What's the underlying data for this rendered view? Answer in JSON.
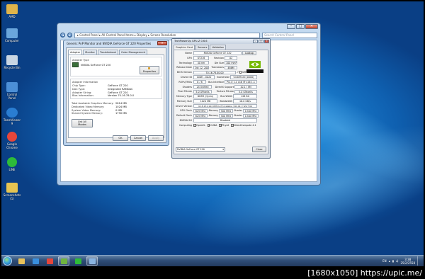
{
  "desktop_icons": [
    {
      "label": "AMD",
      "color": "#e0b44a"
    },
    {
      "label": "Computer",
      "color": "#6aa6dc"
    },
    {
      "label": "Recycle Bin",
      "color": "#c9d6e3"
    },
    {
      "label": "Control Panel",
      "color": "#4c8fd6"
    },
    {
      "label": "TeamViewer 9",
      "color": "#2a7dd1"
    },
    {
      "label": "Google Chrome",
      "color": "#e5463b"
    },
    {
      "label": "LINE",
      "color": "#2dbb39"
    },
    {
      "label": "Screenshots (1)",
      "color": "#e6c451"
    }
  ],
  "explorer": {
    "nav_back": "◄",
    "nav_fwd": "►",
    "breadcrumb": "▸ Control Panel ▸ All Control Panel Items ▸ Display ▸ Screen Resolution",
    "search_placeholder": "Search Control Panel",
    "btn_min": "–",
    "btn_max": "□",
    "btn_close": "✕"
  },
  "props": {
    "title": "Generic PnP Monitor and NVIDIA GeForce GT 220 Properties",
    "close": "✕",
    "tabs": [
      "Adapter",
      "Monitor",
      "Troubleshoot",
      "Color Management"
    ],
    "adapter_type_label": "Adapter Type",
    "adapter_type_value": "NVIDIA GeForce GT 220",
    "properties_button": "Properties",
    "info_label": "Adapter Information",
    "info": [
      {
        "k": "Chip Type:",
        "v": "GeForce GT 220"
      },
      {
        "k": "DAC Type:",
        "v": "Integrated RAMDAC"
      },
      {
        "k": "Adapter String:",
        "v": "GeForce GT 220"
      },
      {
        "k": "Bios Information:",
        "v": "Version 70.16.78.0.0"
      }
    ],
    "memory": [
      {
        "k": "Total Available Graphics Memory:",
        "v": "2814 MB"
      },
      {
        "k": "Dedicated Video Memory:",
        "v": "1024 MB"
      },
      {
        "k": "System Video Memory:",
        "v": "0 MB"
      },
      {
        "k": "Shared System Memory:",
        "v": "1790 MB"
      }
    ],
    "list_modes_button": "List All Modes",
    "ok": "OK",
    "cancel": "Cancel",
    "apply": "Apply"
  },
  "gpuz": {
    "title": "TechPowerUp GPU-Z 0.6.6",
    "cb_min": "–",
    "cb_max": "□",
    "cb_close": "✕",
    "tabs": [
      "Graphics Card",
      "Sensors",
      "Validation"
    ],
    "name_label": "Name",
    "name": "NVIDIA GeForce GT 220",
    "lookup": "Lookup",
    "gpu_label": "GPU",
    "gpu": "GT216",
    "revision_label": "Revision",
    "revision": "A2",
    "tech_label": "Technology",
    "tech": "40 nm",
    "die_label": "Die Size",
    "die": "100 mm²",
    "release_label": "Release Date",
    "release": "Oct 12, 2009",
    "transistors_label": "Transistors",
    "transistors": "486M",
    "bios_label": "BIOS Version",
    "bios": "70.16.78.00.00",
    "uefi_label": "UEFI",
    "devid_label": "Device ID",
    "devid": "10DE - 0A20",
    "subvendor_label": "Subvendor",
    "subvendor": "Undefined (0000)",
    "rops_label": "ROPs/TMUs",
    "rops": "8 / 8",
    "bus_label": "Bus Interface",
    "bus": "PCI-E 1.1 x16 @ x16 1.1",
    "shaders_label": "Shaders",
    "shaders": "24 Unified",
    "dx_label": "DirectX Support",
    "dx": "10.1 / SM",
    "pixel_label": "Pixel Fillrate",
    "pixel": "5.0 GPixel/s",
    "texture_label": "Texture Fillrate",
    "texture": "5.0 GTexel/s",
    "memtype_label": "Memory Type",
    "memtype": "DDR3 (Hynix)",
    "buswidth_label": "Bus Width",
    "buswidth": "128 Bit",
    "memsize_label": "Memory Size",
    "memsize": "1024 MB",
    "bandwidth_label": "Bandwidth",
    "bandwidth": "16.0 GB/s",
    "driver_label": "Driver Version",
    "driver": "9.18.13.4144 WHQL (ForceWare 341.44) / Win7 64",
    "gpuclock_label": "GPU Clock",
    "gpuclock": "625 MHz",
    "mem_label": "Memory",
    "gpumem": "500 MHz",
    "shader_label": "Shader",
    "gpushader": "1340 MHz",
    "defclock_label": "Default Clock",
    "defclock": "625 MHz",
    "defmem": "500 MHz",
    "defshader": "1340 MHz",
    "sli_label": "NVIDIA SLI",
    "sli": "Disabled",
    "computing_label": "Computing",
    "computing": [
      "OpenCL",
      "CUDA",
      "PhysX",
      "DirectCompute 4.1"
    ],
    "check": "✓",
    "selected_card": "NVIDIA GeForce GT 220",
    "close_button": "Close"
  },
  "taskbar": {
    "items": [
      {
        "name": "explorer",
        "color": "#e7c15a",
        "open": false
      },
      {
        "name": "ie",
        "color": "#3a8fdd",
        "open": false
      },
      {
        "name": "chrome",
        "color": "#e5463b",
        "open": false
      },
      {
        "name": "gpuz",
        "color": "#6fb43f",
        "open": true
      },
      {
        "name": "line",
        "color": "#2dbb39",
        "open": false
      },
      {
        "name": "control-panel",
        "color": "#8ab4e0",
        "open": true
      }
    ],
    "lang": "EN",
    "time": "3:38",
    "date": "25/2/2558"
  },
  "watermark": "[1680x1050] https://upic.me/"
}
